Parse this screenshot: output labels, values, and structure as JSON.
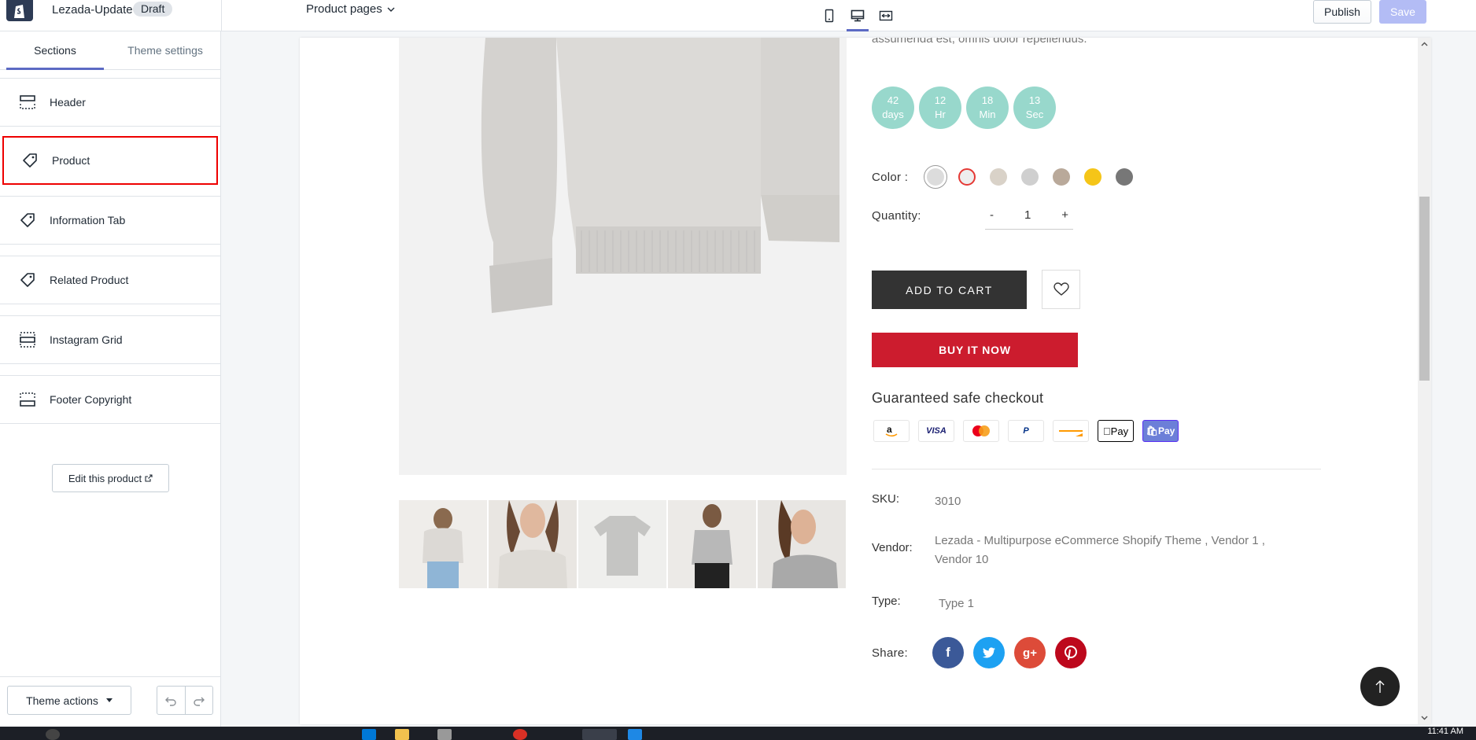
{
  "topbar": {
    "theme_name": "Lezada-Update",
    "status_badge": "Draft",
    "page_selector": "Product pages",
    "publish_label": "Publish",
    "save_label": "Save"
  },
  "sidebar": {
    "tabs": [
      {
        "label": "Sections",
        "active": true
      },
      {
        "label": "Theme settings",
        "active": false
      }
    ],
    "items": [
      {
        "label": "Header",
        "icon": "header-layout-icon"
      },
      {
        "label": "Product",
        "icon": "tag-icon"
      },
      {
        "label": "Information Tab",
        "icon": "tag-icon"
      },
      {
        "label": "Related Product",
        "icon": "tag-icon"
      },
      {
        "label": "Instagram Grid",
        "icon": "grid-layout-icon"
      },
      {
        "label": "Footer Copyright",
        "icon": "footer-layout-icon"
      }
    ],
    "edit_product_label": "Edit this product",
    "theme_actions_label": "Theme actions"
  },
  "product": {
    "description_tail": "assumenda est, omnis dolor repellendus.",
    "countdown": [
      {
        "value": "42",
        "unit": "days"
      },
      {
        "value": "12",
        "unit": "Hr"
      },
      {
        "value": "18",
        "unit": "Min"
      },
      {
        "value": "13",
        "unit": "Sec"
      }
    ],
    "color_label": "Color :",
    "quantity_label": "Quantity:",
    "quantity_minus": "-",
    "quantity_value": "1",
    "quantity_plus": "+",
    "add_to_cart_label": "ADD TO CART",
    "buy_now_label": "BUY IT NOW",
    "guarantee_label": "Guaranteed safe checkout",
    "payments": [
      "amazon",
      "VISA",
      "mastercard",
      "PayPal",
      "card",
      "Pay",
      "Pay"
    ],
    "sku_label": "SKU:",
    "sku_value": "3010",
    "vendor_label": "Vendor:",
    "vendor_value_line1": "Lezada - Multipurpose eCommerce Shopify Theme , Vendor 1 ,",
    "vendor_value_line2": "Vendor 10",
    "type_label": "Type:",
    "type_value": "Type 1",
    "share_label": "Share:",
    "share_networks": [
      "f",
      "twitter",
      "g+",
      "P"
    ]
  },
  "colors": {
    "accent": "#5c6ac4",
    "countdown": "#98d8cc",
    "add_to_cart": "#333333",
    "buy_now": "#cc1c2e",
    "highlight": "#ee0000"
  },
  "taskbar": {
    "clock": "11:41 AM"
  }
}
